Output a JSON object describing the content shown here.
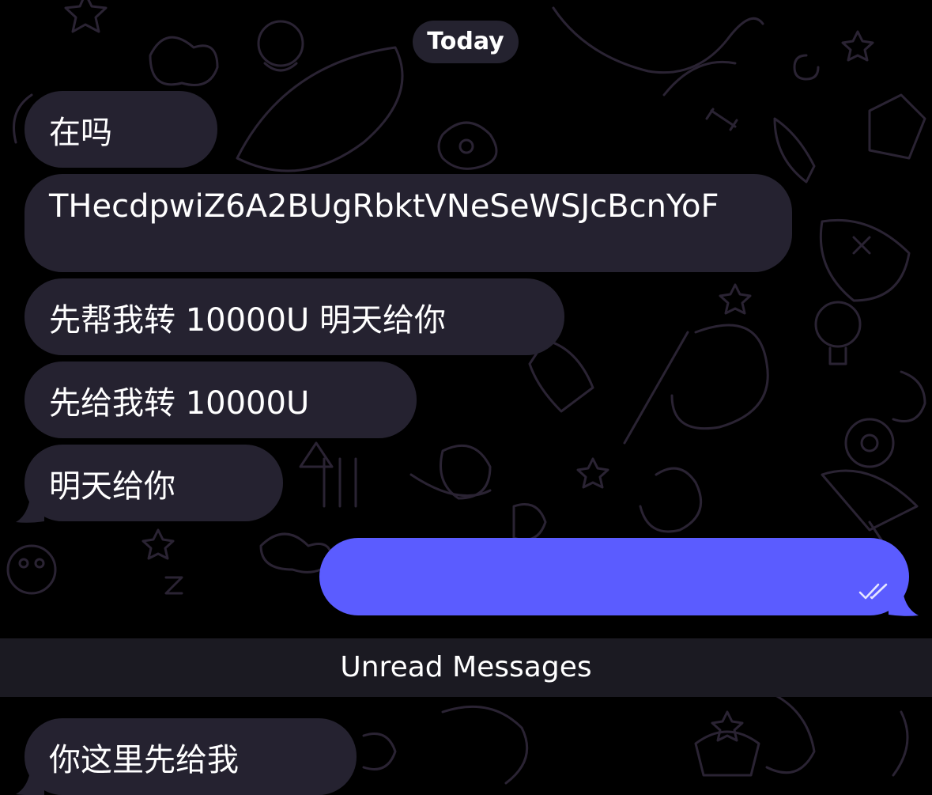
{
  "chat": {
    "date_separator": "Today",
    "messages": [
      {
        "direction": "incoming",
        "text": "在吗"
      },
      {
        "direction": "incoming",
        "text": "THecdpwiZ6A2BUgRbktVNeSeWSJcBcnYoF"
      },
      {
        "direction": "incoming",
        "text": "先帮我转 10000U 明天给你"
      },
      {
        "direction": "incoming",
        "text": "先给我转 10000U"
      },
      {
        "direction": "incoming",
        "text": "明天给你"
      },
      {
        "direction": "outgoing",
        "text": "",
        "status": "read",
        "status_icon": "double-check-icon"
      }
    ],
    "unread_divider": "Unread Messages",
    "after_unread": [
      {
        "direction": "incoming",
        "text": "你这里先给我"
      }
    ]
  },
  "colors": {
    "background": "#000000",
    "incoming_bubble": "#252230",
    "outgoing_bubble": "#5b5cff",
    "unread_bar": "#1b1a22",
    "text": "#ffffff"
  }
}
